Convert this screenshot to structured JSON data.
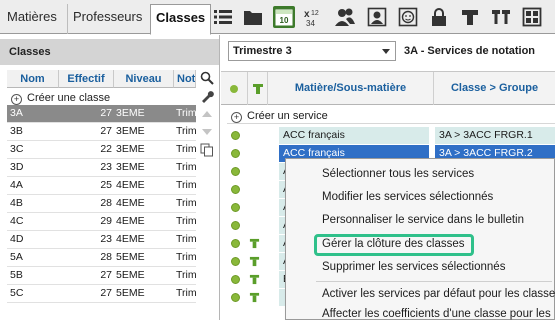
{
  "tabs": [
    {
      "label": "Matières"
    },
    {
      "label": "Professeurs"
    },
    {
      "label": "Classes"
    }
  ],
  "toolbar_icons": [
    "list-icon",
    "folder-icon",
    "calendar-10-icon",
    "x-squared-icon",
    "users-icon",
    "portrait-icon",
    "face-icon",
    "lock-icon",
    "t-symbol-icon",
    "double-t-icon",
    "grid-icon"
  ],
  "toolbar_calendar_text": "10",
  "left": {
    "title": "Classes",
    "columns": [
      "Nom",
      "Effectif",
      "Niveau",
      "Not"
    ],
    "create_label": "Créer une classe",
    "rows": [
      {
        "nom": "3A",
        "effectif": "27",
        "niveau": "3EME",
        "not": "Trim"
      },
      {
        "nom": "3B",
        "effectif": "27",
        "niveau": "3EME",
        "not": "Trim"
      },
      {
        "nom": "3C",
        "effectif": "22",
        "niveau": "3EME",
        "not": "Trim"
      },
      {
        "nom": "3D",
        "effectif": "23",
        "niveau": "3EME",
        "not": "Trim"
      },
      {
        "nom": "4A",
        "effectif": "25",
        "niveau": "4EME",
        "not": "Trim"
      },
      {
        "nom": "4B",
        "effectif": "28",
        "niveau": "4EME",
        "not": "Trim"
      },
      {
        "nom": "4C",
        "effectif": "29",
        "niveau": "4EME",
        "not": "Trim"
      },
      {
        "nom": "4D",
        "effectif": "23",
        "niveau": "4EME",
        "not": "Trim"
      },
      {
        "nom": "5A",
        "effectif": "28",
        "niveau": "5EME",
        "not": "Trim"
      },
      {
        "nom": "5B",
        "effectif": "27",
        "niveau": "5EME",
        "not": "Trim"
      },
      {
        "nom": "5C",
        "effectif": "27",
        "niveau": "5EME",
        "not": "Trim"
      }
    ]
  },
  "right": {
    "period_select": "Trimestre 3",
    "title": "3A - Services de notation",
    "columns": [
      "Matière/Sous-matière",
      "Classe > Groupe"
    ],
    "create_label": "Créer un service",
    "services": [
      {
        "matiere": "ACC français",
        "classe": "3A > 3ACC FRGR.1"
      },
      {
        "matiere": "ACC français",
        "classe": "3A > 3ACC FRGR.2"
      },
      {
        "matiere": "A",
        "classe": ""
      },
      {
        "matiere": "A",
        "classe": ""
      },
      {
        "matiere": "A",
        "classe": ""
      },
      {
        "matiere": "A",
        "classe": ""
      },
      {
        "matiere": "A",
        "classe": ""
      },
      {
        "matiere": "A",
        "classe": ""
      },
      {
        "matiere": "É",
        "classe": ""
      },
      {
        "matiere": "É",
        "classe": ""
      }
    ]
  },
  "context_menu": [
    {
      "label": "Sélectionner tous les services"
    },
    {
      "label": "Modifier les services sélectionnés"
    },
    {
      "label": "Personnaliser le service dans le bulletin"
    },
    {
      "label": "Gérer la clôture des classes"
    },
    {
      "label": "Supprimer les services sélectionnés"
    },
    {
      "label": "Activer les services par défaut pour les classe"
    },
    {
      "label": "Affecter les coefficients d'une classe pour les"
    }
  ],
  "colors": {
    "accent_green": "#2fc08a",
    "selection_blue": "#2f6fc6",
    "header_blue": "#1a5f9e",
    "active_icon_bg": "#3d7a2b"
  }
}
